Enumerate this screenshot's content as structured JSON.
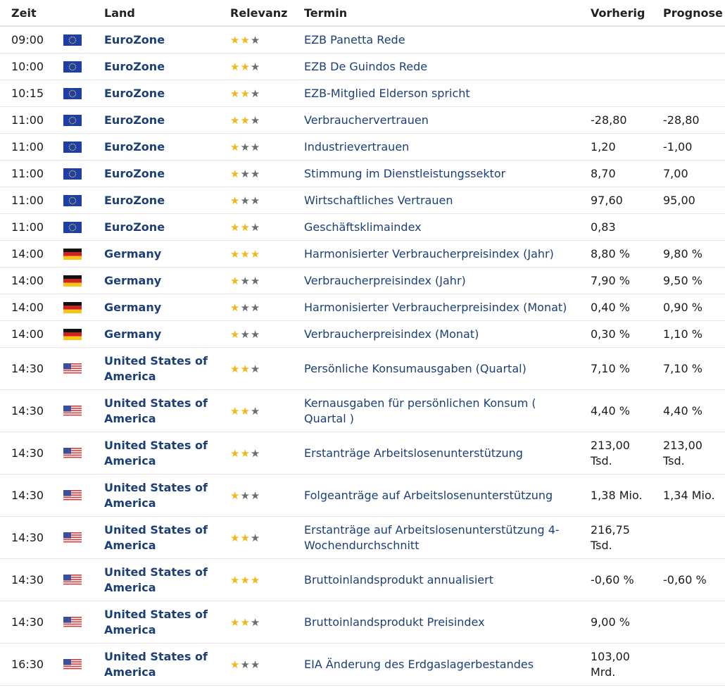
{
  "colors": {
    "star_on": "#f2b71b",
    "star_off": "#6d6d6d",
    "link": "#1d3f78"
  },
  "headers": {
    "zeit": "Zeit",
    "flag": "",
    "land": "Land",
    "relevanz": "Relevanz",
    "termin": "Termin",
    "vorherig": "Vorherig",
    "prognose": "Prognose"
  },
  "rows": [
    {
      "zeit": "09:00",
      "flag": "eu-flag-icon",
      "land": "EuroZone",
      "relevanz": 2,
      "termin": "EZB Panetta Rede",
      "vorherig": "",
      "prognose": ""
    },
    {
      "zeit": "10:00",
      "flag": "eu-flag-icon",
      "land": "EuroZone",
      "relevanz": 2,
      "termin": "EZB De Guindos Rede",
      "vorherig": "",
      "prognose": ""
    },
    {
      "zeit": "10:15",
      "flag": "eu-flag-icon",
      "land": "EuroZone",
      "relevanz": 2,
      "termin": "EZB-Mitglied Elderson spricht",
      "vorherig": "",
      "prognose": ""
    },
    {
      "zeit": "11:00",
      "flag": "eu-flag-icon",
      "land": "EuroZone",
      "relevanz": 2,
      "termin": "Verbrauchervertrauen",
      "vorherig": "-28,80",
      "prognose": "-28,80"
    },
    {
      "zeit": "11:00",
      "flag": "eu-flag-icon",
      "land": "EuroZone",
      "relevanz": 1,
      "termin": "Industrievertrauen",
      "vorherig": "1,20",
      "prognose": "-1,00"
    },
    {
      "zeit": "11:00",
      "flag": "eu-flag-icon",
      "land": "EuroZone",
      "relevanz": 1,
      "termin": "Stimmung im Dienstleistungssektor",
      "vorherig": "8,70",
      "prognose": "7,00"
    },
    {
      "zeit": "11:00",
      "flag": "eu-flag-icon",
      "land": "EuroZone",
      "relevanz": 1,
      "termin": "Wirtschaftliches Vertrauen",
      "vorherig": "97,60",
      "prognose": "95,00"
    },
    {
      "zeit": "11:00",
      "flag": "eu-flag-icon",
      "land": "EuroZone",
      "relevanz": 2,
      "termin": "Geschäftsklimaindex",
      "vorherig": "0,83",
      "prognose": ""
    },
    {
      "zeit": "14:00",
      "flag": "de-flag-icon",
      "land": "Germany",
      "relevanz": 3,
      "termin": "Harmonisierter Verbraucherpreisindex (Jahr)",
      "vorherig": "8,80 %",
      "prognose": "9,80 %"
    },
    {
      "zeit": "14:00",
      "flag": "de-flag-icon",
      "land": "Germany",
      "relevanz": 1,
      "termin": "Verbraucherpreisindex (Jahr)",
      "vorherig": "7,90 %",
      "prognose": "9,50 %"
    },
    {
      "zeit": "14:00",
      "flag": "de-flag-icon",
      "land": "Germany",
      "relevanz": 1,
      "termin": "Harmonisierter Verbraucherpreisindex (Monat)",
      "vorherig": "0,40 %",
      "prognose": "0,90 %"
    },
    {
      "zeit": "14:00",
      "flag": "de-flag-icon",
      "land": "Germany",
      "relevanz": 1,
      "termin": "Verbraucherpreisindex (Monat)",
      "vorherig": "0,30 %",
      "prognose": "1,10 %"
    },
    {
      "zeit": "14:30",
      "flag": "us-flag-icon",
      "land": "United States of America",
      "relevanz": 2,
      "termin": "Persönliche Konsumausgaben (Quartal)",
      "vorherig": "7,10 %",
      "prognose": "7,10 %"
    },
    {
      "zeit": "14:30",
      "flag": "us-flag-icon",
      "land": "United States of America",
      "relevanz": 2,
      "termin": "Kernausgaben für persönlichen Konsum ( Quartal )",
      "vorherig": "4,40 %",
      "prognose": "4,40 %"
    },
    {
      "zeit": "14:30",
      "flag": "us-flag-icon",
      "land": "United States of America",
      "relevanz": 2,
      "termin": "Erstanträge Arbeitslosenunterstützung",
      "vorherig": "213,00 Tsd.",
      "prognose": "213,00 Tsd."
    },
    {
      "zeit": "14:30",
      "flag": "us-flag-icon",
      "land": "United States of America",
      "relevanz": 1,
      "termin": "Folgeanträge auf Arbeitslosenunterstützung",
      "vorherig": "1,38 Mio.",
      "prognose": "1,34 Mio."
    },
    {
      "zeit": "14:30",
      "flag": "us-flag-icon",
      "land": "United States of America",
      "relevanz": 2,
      "termin": "Erstanträge auf Arbeitslosenunterstützung 4-Wochendurchschnitt",
      "vorherig": "216,75 Tsd.",
      "prognose": ""
    },
    {
      "zeit": "14:30",
      "flag": "us-flag-icon",
      "land": "United States of America",
      "relevanz": 3,
      "termin": "Bruttoinlandsprodukt annualisiert",
      "vorherig": "-0,60 %",
      "prognose": "-0,60 %"
    },
    {
      "zeit": "14:30",
      "flag": "us-flag-icon",
      "land": "United States of America",
      "relevanz": 2,
      "termin": "Bruttoinlandsprodukt Preisindex",
      "vorherig": "9,00 %",
      "prognose": ""
    },
    {
      "zeit": "16:30",
      "flag": "us-flag-icon",
      "land": "United States of America",
      "relevanz": 1,
      "termin": "EIA Änderung des Erdgaslagerbestandes",
      "vorherig": "103,00 Mrd.",
      "prognose": ""
    }
  ]
}
